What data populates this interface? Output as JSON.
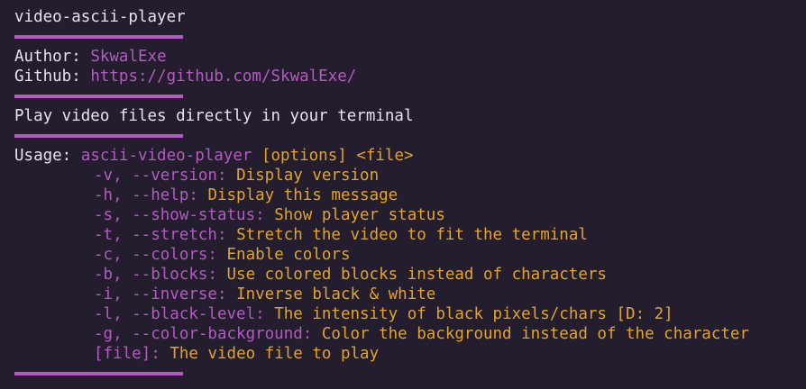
{
  "title": "video-ascii-player",
  "author": {
    "label": "Author:",
    "value": "SkwalExe"
  },
  "github": {
    "label": "Github:",
    "value": "https://github.com/SkwalExe/"
  },
  "description": "Play video files directly in your terminal",
  "usage": {
    "label": "Usage:",
    "command": "ascii-video-player",
    "args": "[options] <file>"
  },
  "options": [
    {
      "flag": "-v, --version:",
      "desc": "Display version"
    },
    {
      "flag": "-h, --help:",
      "desc": "Display this message"
    },
    {
      "flag": "-s, --show-status:",
      "desc": "Show player status"
    },
    {
      "flag": "-t, --stretch:",
      "desc": "Stretch the video to fit the terminal"
    },
    {
      "flag": "-c, --colors:",
      "desc": "Enable colors"
    },
    {
      "flag": "-b, --blocks:",
      "desc": "Use colored blocks instead of characters"
    },
    {
      "flag": "-i, --inverse:",
      "desc": "Inverse black & white"
    },
    {
      "flag": "-l, --black-level:",
      "desc": "The intensity of black pixels/chars [D: 2]"
    },
    {
      "flag": "-g, --color-background:",
      "desc": "Color the background instead of the character"
    },
    {
      "flag": "[file]:",
      "desc": "The video file to play"
    }
  ],
  "colors": {
    "background": "#231d2e",
    "text": "#e6e2ee",
    "accent_purple": "#b35bc1",
    "accent_orange": "#e2a42a"
  }
}
